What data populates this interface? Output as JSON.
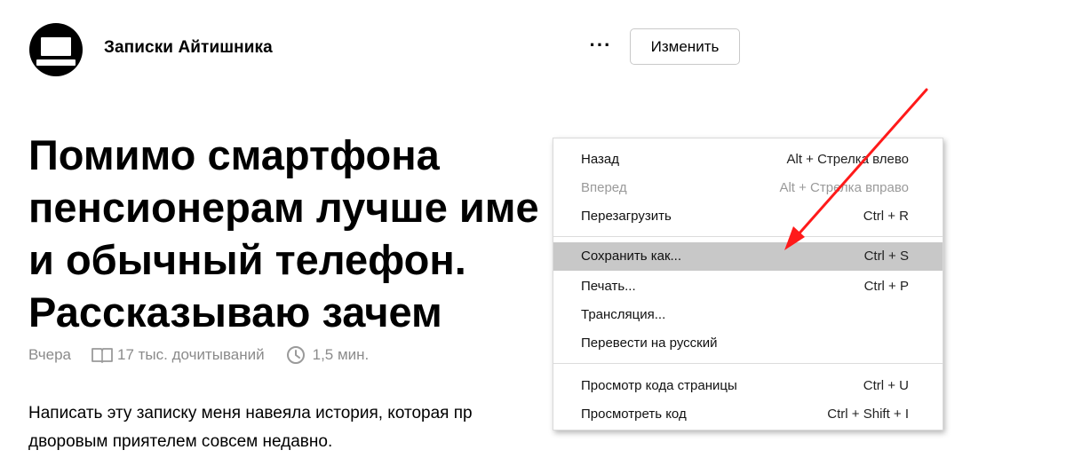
{
  "channel": {
    "name": "Записки Айтишника",
    "more_label": "···",
    "edit_label": "Изменить"
  },
  "article": {
    "title_lines": [
      "Помимо смартфона",
      "пенсионерам лучше име",
      "и обычный телефон.",
      "Рассказываю зачем"
    ],
    "date": "Вчера",
    "reads": "17 тыс. дочитываний",
    "read_time": "1,5 мин.",
    "body_lines": [
      "Написать эту записку меня навеяла история, которая пр",
      "дворовым приятелем совсем недавно."
    ]
  },
  "context_menu": {
    "groups": [
      [
        {
          "label": "Назад",
          "shortcut": "Alt + Стрелка влево",
          "enabled": true,
          "highlighted": false
        },
        {
          "label": "Вперед",
          "shortcut": "Alt + Стрелка вправо",
          "enabled": false,
          "highlighted": false
        },
        {
          "label": "Перезагрузить",
          "shortcut": "Ctrl + R",
          "enabled": true,
          "highlighted": false
        }
      ],
      [
        {
          "label": "Сохранить как...",
          "shortcut": "Ctrl + S",
          "enabled": true,
          "highlighted": true
        },
        {
          "label": "Печать...",
          "shortcut": "Ctrl + P",
          "enabled": true,
          "highlighted": false
        },
        {
          "label": "Трансляция...",
          "shortcut": "",
          "enabled": true,
          "highlighted": false
        },
        {
          "label": "Перевести на русский",
          "shortcut": "",
          "enabled": true,
          "highlighted": false
        }
      ],
      [
        {
          "label": "Просмотр кода страницы",
          "shortcut": "Ctrl + U",
          "enabled": true,
          "highlighted": false
        },
        {
          "label": "Просмотреть код",
          "shortcut": "Ctrl + Shift + I",
          "enabled": true,
          "highlighted": false
        }
      ]
    ]
  },
  "colors": {
    "menu_highlight": "#c8c8c8",
    "annotation_arrow": "#ff1a1a",
    "meta_text": "#8b8b8b"
  },
  "icons": {
    "logo": "laptop-icon",
    "reads": "book-icon",
    "time": "clock-icon"
  }
}
